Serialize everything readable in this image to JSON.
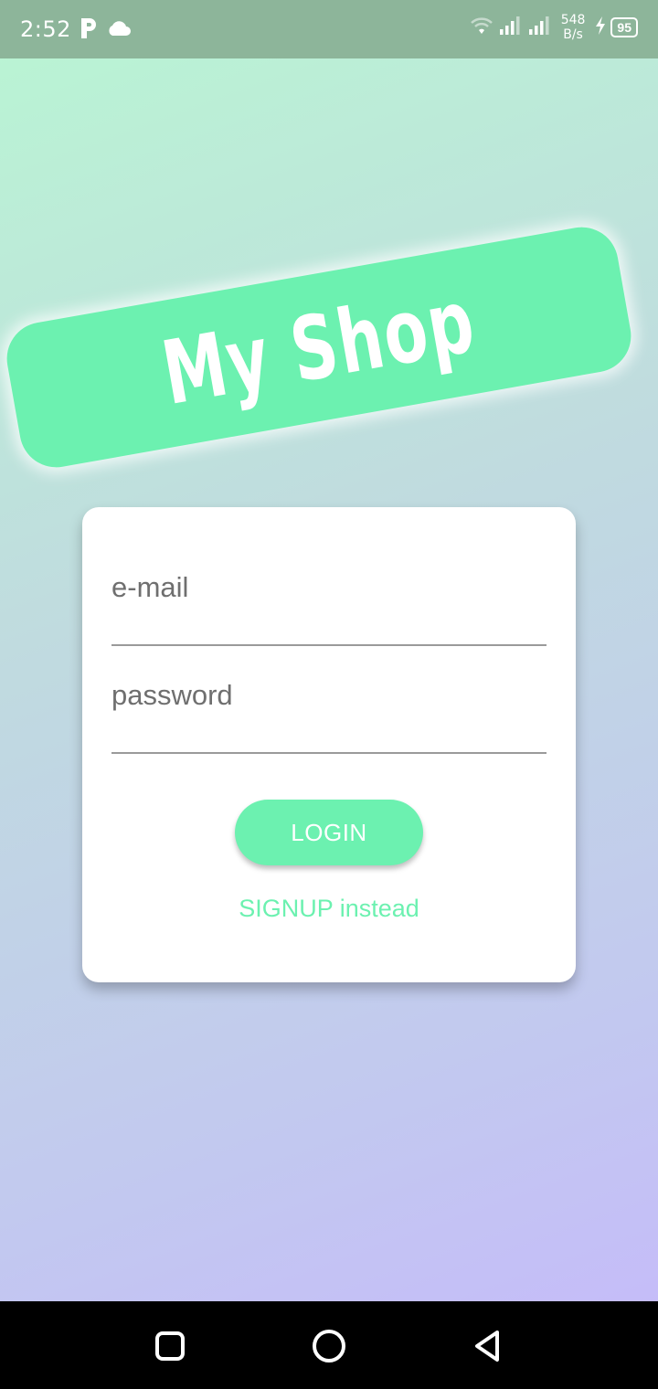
{
  "status_bar": {
    "time": "2:52",
    "left_icons": [
      "parking-p-icon",
      "cloud-icon"
    ],
    "right_icons": [
      "wifi-icon",
      "signal-icon",
      "signal-icon",
      "charging-bolt-icon"
    ],
    "net_speed_value": "548",
    "net_speed_unit": "B/s",
    "battery_level": "95"
  },
  "logo": {
    "text": "My Shop"
  },
  "login_form": {
    "email_placeholder": "e-mail",
    "password_placeholder": "password",
    "login_label": "LOGIN",
    "signup_label": "SIGNUP instead"
  },
  "nav_bar": {
    "icons": [
      "recents-icon",
      "home-icon",
      "back-icon"
    ]
  },
  "colors": {
    "accent": "#6cf1b0",
    "status_bar": "#8db59a",
    "card": "#ffffff",
    "placeholder": "#6f6f6f"
  }
}
